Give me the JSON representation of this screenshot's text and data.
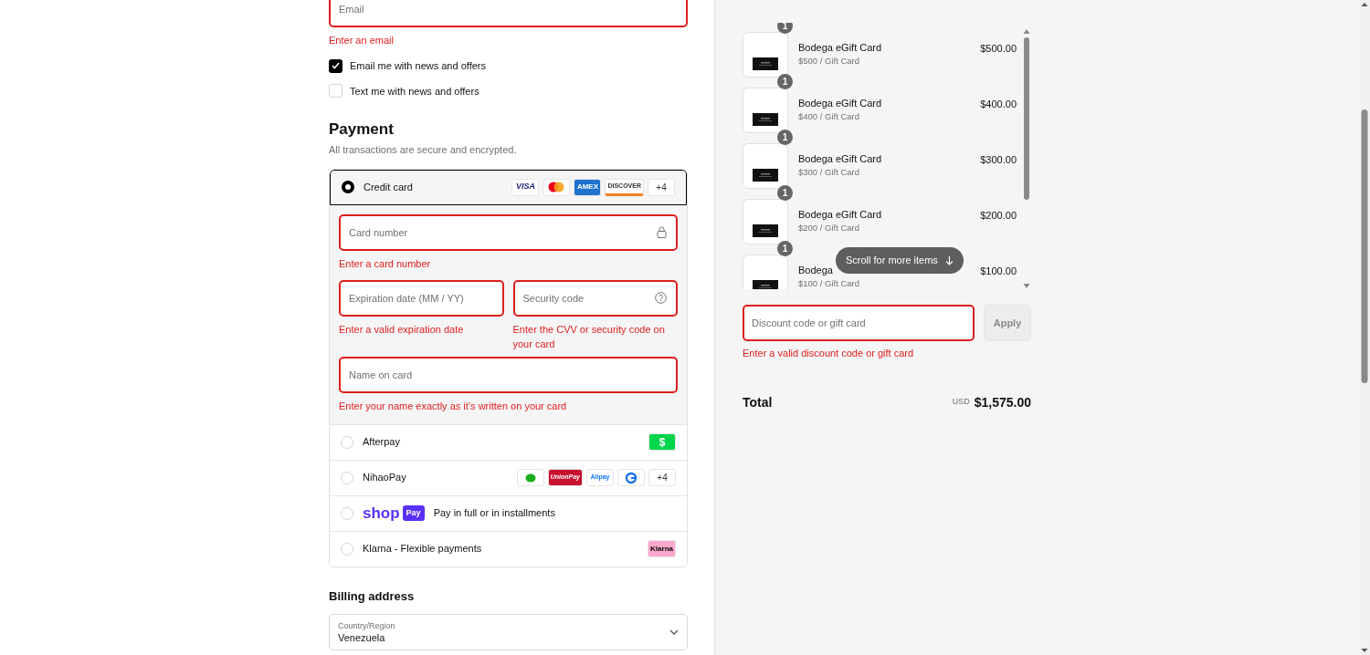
{
  "contact": {
    "email": {
      "placeholder": "Email",
      "error": "Enter an email"
    },
    "marketing": [
      {
        "label": "Email me with news and offers",
        "checked": true
      },
      {
        "label": "Text me with news and offers",
        "checked": false
      }
    ]
  },
  "payment": {
    "title": "Payment",
    "subtitle": "All transactions are secure and encrypted.",
    "methods": [
      {
        "kind": "card",
        "label": "Credit card",
        "selected": true,
        "logos": [
          {
            "kind": "visa",
            "text": "VISA"
          },
          {
            "kind": "mastercard"
          },
          {
            "kind": "amex",
            "text": "AMEX"
          },
          {
            "kind": "discover",
            "text": "DISCOVER"
          },
          {
            "kind": "more",
            "text": "+4"
          }
        ]
      },
      {
        "kind": "plain",
        "label": "Afterpay",
        "selected": false,
        "logos": [
          {
            "kind": "cash",
            "text": "$"
          }
        ]
      },
      {
        "kind": "plain",
        "label": "NihaoPay",
        "selected": false,
        "logos": [
          {
            "kind": "wechat"
          },
          {
            "kind": "unionpay",
            "text": "UnionPay"
          },
          {
            "kind": "alipay",
            "text": "Alipay"
          },
          {
            "kind": "gpay"
          },
          {
            "kind": "more",
            "text": "+4"
          }
        ]
      },
      {
        "kind": "shoppay",
        "brand": "shop",
        "badge": "Pay",
        "label": "Pay in full or in installments",
        "selected": false
      },
      {
        "kind": "plain",
        "label": "Klarna - Flexible payments",
        "selected": false,
        "logos": [
          {
            "kind": "klarna",
            "text": "Klarna"
          }
        ]
      }
    ],
    "card_form": {
      "card_number": {
        "placeholder": "Card number",
        "error": "Enter a card number"
      },
      "expiration": {
        "placeholder": "Expiration date (MM / YY)",
        "error": "Enter a valid expiration date"
      },
      "security_code": {
        "placeholder": "Security code",
        "error": "Enter the CVV or security code on your card"
      },
      "name": {
        "placeholder": "Name on card",
        "error": "Enter your name exactly as it’s written on your card"
      }
    }
  },
  "billing": {
    "title": "Billing address",
    "country": {
      "label": "Country/Region",
      "value": "Venezuela"
    }
  },
  "summary": {
    "items": [
      {
        "quantity": "1",
        "name": "Bodega eGift Card",
        "variant": "$500 / Gift Card",
        "price": "$500.00"
      },
      {
        "quantity": "1",
        "name": "Bodega eGift Card",
        "variant": "$400 / Gift Card",
        "price": "$400.00"
      },
      {
        "quantity": "1",
        "name": "Bodega eGift Card",
        "variant": "$300 / Gift Card",
        "price": "$300.00"
      },
      {
        "quantity": "1",
        "name": "Bodega eGift Card",
        "variant": "$200 / Gift Card",
        "price": "$200.00"
      },
      {
        "quantity": "1",
        "name": "Bodega",
        "variant": "$100 / Gift Card",
        "price": "$100.00"
      }
    ],
    "scroll_hint": "Scroll for more items",
    "discount": {
      "placeholder": "Discount code or gift card",
      "error": "Enter a valid discount code or gift card",
      "button": "Apply"
    },
    "total": {
      "label": "Total",
      "currency": "USD",
      "amount": "$1,575.00"
    }
  }
}
